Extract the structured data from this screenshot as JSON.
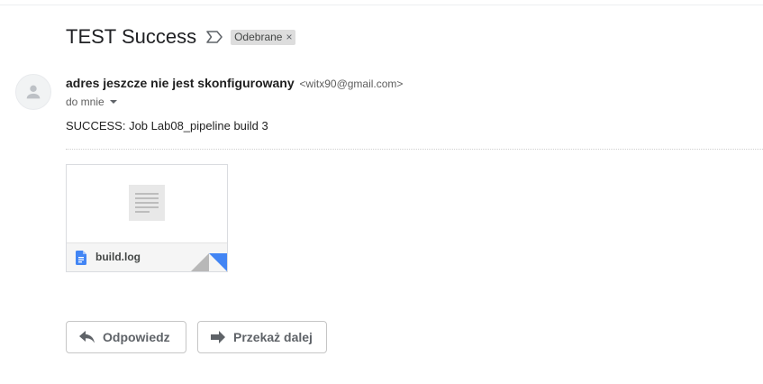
{
  "email": {
    "subject": "TEST Success",
    "label": "Odebrane",
    "label_remove": "×",
    "sender_name": "adres jeszcze nie jest skonfigurowany",
    "sender_email": "<witx90@gmail.com>",
    "recipient": "do mnie",
    "body": "SUCCESS: Job Lab08_pipeline build 3",
    "attachment": {
      "filename": "build.log"
    }
  },
  "actions": {
    "reply": "Odpowiedz",
    "forward": "Przekaż dalej"
  },
  "colors": {
    "label_bg": "#dddddd",
    "file_icon": "#4285f4",
    "muted_text": "#5f6368"
  }
}
